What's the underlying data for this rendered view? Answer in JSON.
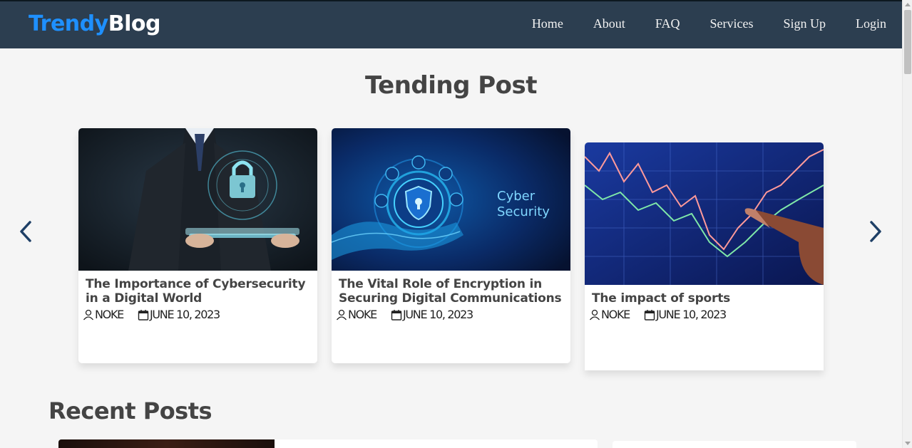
{
  "header": {
    "logo_part1": "Trendy",
    "logo_part2": "Blog",
    "nav": [
      "Home",
      "About",
      "FAQ",
      "Services",
      "Sign Up",
      "Login"
    ]
  },
  "trending": {
    "title": "Tending Post",
    "cards": [
      {
        "title": "The Importance of Cybersecurity in a Digital World",
        "author": "NOKE",
        "date": "JUNE 10, 2023"
      },
      {
        "title": "The Vital Role of Encryption in Securing Digital Communications",
        "author": "NOKE",
        "date": "JUNE 10, 2023",
        "image_text": [
          "Cyber",
          "Security"
        ]
      },
      {
        "title": "The impact of sports",
        "author": "NOKE",
        "date": "JUNE 10, 2023"
      }
    ]
  },
  "recent": {
    "title": "Recent Posts"
  },
  "colors": {
    "header_bg": "#2c3e50",
    "logo_accent": "#1e90ff",
    "chevron": "#1e3f66"
  },
  "icons": [
    "chevron-left-icon",
    "chevron-right-icon",
    "user-icon",
    "calendar-icon"
  ]
}
